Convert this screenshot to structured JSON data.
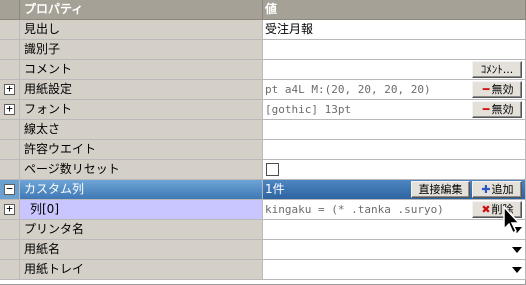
{
  "header": {
    "property": "プロパティ",
    "value": "値"
  },
  "rows": [
    {
      "name": "見出し",
      "value": "受注月報"
    },
    {
      "name": "識別子",
      "value": ""
    },
    {
      "name": "コメント",
      "value": "",
      "button": "ｺﾒﾝﾄ..."
    },
    {
      "name": "用紙設定",
      "expander": "+",
      "value": "pt a4L M:(20, 20, 20, 20)",
      "button": "無効"
    },
    {
      "name": "フォント",
      "expander": "+",
      "value": "[gothic] 13pt",
      "button": "無効"
    },
    {
      "name": "線太さ",
      "value": ""
    },
    {
      "name": "許容ウエイト",
      "value": ""
    },
    {
      "name": "ページ数リセット",
      "value": ""
    },
    {
      "name": "カスタム列",
      "expander": "−",
      "value": "1件",
      "button1": "直接編集",
      "button2": "追加"
    },
    {
      "name": "列[0]",
      "expander": "+",
      "value": "kingaku = (* .tanka .suryo)",
      "button": "削除"
    },
    {
      "name": "プリンタ名",
      "value": ""
    },
    {
      "name": "用紙名",
      "value": ""
    },
    {
      "name": "用紙トレイ",
      "value": ""
    }
  ],
  "icons": {
    "disable": "minus-icon",
    "add": "plus-icon",
    "delete": "x-icon",
    "dropdown": "chevron-down-icon"
  },
  "colors": {
    "header_bg": "#a5a196",
    "name_bg": "#d4d0c8",
    "selected_bg": "#3f78b5",
    "child_bg": "#c9c5ff"
  }
}
